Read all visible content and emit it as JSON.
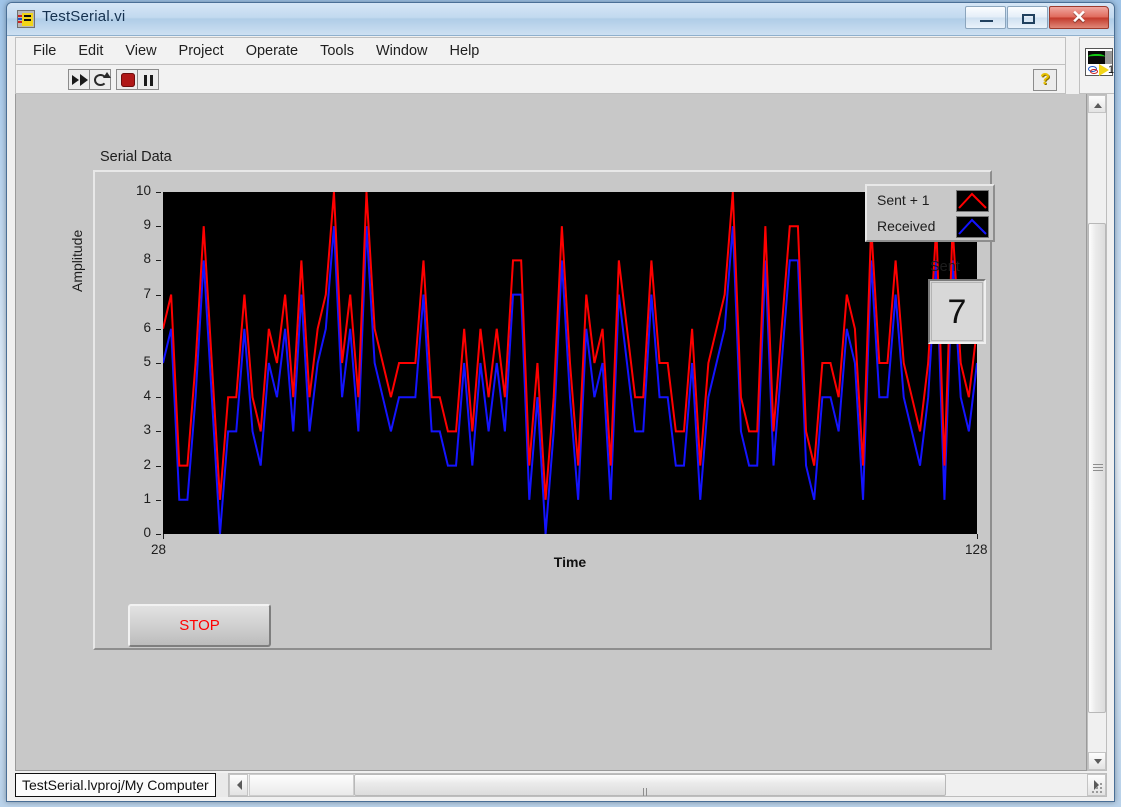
{
  "window": {
    "title": "TestSerial.vi",
    "icon": "labview-vi-icon",
    "minimize": "–",
    "maximize": "□",
    "close": "✕"
  },
  "menubar": {
    "items": [
      {
        "label": "File"
      },
      {
        "label": "Edit"
      },
      {
        "label": "View"
      },
      {
        "label": "Project"
      },
      {
        "label": "Operate"
      },
      {
        "label": "Tools"
      },
      {
        "label": "Window"
      },
      {
        "label": "Help"
      }
    ]
  },
  "toolbar": {
    "run": "run-arrow-icon",
    "run_continuously": "run-continuously-icon",
    "abort": "abort-execution-icon",
    "pause": "pause-icon",
    "help": "?",
    "vi_icon_number": "1"
  },
  "panel": {
    "graph_label": "Serial Data",
    "legend": {
      "rows": [
        {
          "name": "Sent + 1",
          "color": "#ff0000"
        },
        {
          "name": "Received",
          "color": "#1414ff"
        }
      ]
    },
    "sent_indicator": {
      "label": "Sent",
      "value": "7"
    },
    "stop_button": {
      "label": "STOP",
      "color": "#ff0000"
    }
  },
  "statusbar": {
    "project_path": "TestSerial.lvproj/My Computer"
  },
  "chart_data": {
    "type": "line",
    "title": "Serial Data",
    "xlabel": "Time",
    "ylabel": "Amplitude",
    "xlim": [
      28,
      128
    ],
    "ylim": [
      0,
      10
    ],
    "xticks": [
      28,
      128
    ],
    "yticks": [
      0,
      1,
      2,
      3,
      4,
      5,
      6,
      7,
      8,
      9,
      10
    ],
    "grid": false,
    "legend_position": "top-right",
    "plot_background": "#000000",
    "x": [
      28,
      29,
      30,
      31,
      32,
      33,
      34,
      35,
      36,
      37,
      38,
      39,
      40,
      41,
      42,
      43,
      44,
      45,
      46,
      47,
      48,
      49,
      50,
      51,
      52,
      53,
      54,
      55,
      56,
      57,
      58,
      59,
      60,
      61,
      62,
      63,
      64,
      65,
      66,
      67,
      68,
      69,
      70,
      71,
      72,
      73,
      74,
      75,
      76,
      77,
      78,
      79,
      80,
      81,
      82,
      83,
      84,
      85,
      86,
      87,
      88,
      89,
      90,
      91,
      92,
      93,
      94,
      95,
      96,
      97,
      98,
      99,
      100,
      101,
      102,
      103,
      104,
      105,
      106,
      107,
      108,
      109,
      110,
      111,
      112,
      113,
      114,
      115,
      116,
      117,
      118,
      119,
      120,
      121,
      122,
      123,
      124,
      125,
      126,
      127,
      128
    ],
    "series": [
      {
        "name": "Sent + 1",
        "color": "#ff0000",
        "values": [
          6,
          7,
          2,
          2,
          5,
          9,
          5,
          1,
          4,
          4,
          7,
          4,
          3,
          6,
          5,
          7,
          4,
          8,
          4,
          6,
          7,
          10,
          5,
          7,
          4,
          10,
          6,
          5,
          4,
          5,
          5,
          5,
          8,
          4,
          4,
          3,
          3,
          6,
          3,
          6,
          4,
          6,
          4,
          8,
          8,
          2,
          5,
          1,
          4,
          9,
          5,
          2,
          7,
          5,
          6,
          2,
          8,
          6,
          4,
          4,
          8,
          5,
          5,
          3,
          3,
          6,
          2,
          5,
          6,
          7,
          10,
          4,
          3,
          3,
          9,
          3,
          6,
          9,
          9,
          3,
          2,
          5,
          5,
          4,
          7,
          6,
          2,
          9,
          5,
          5,
          8,
          5,
          4,
          3,
          5,
          9,
          2,
          9,
          5,
          4,
          6
        ]
      },
      {
        "name": "Received",
        "color": "#1414ff",
        "values": [
          5,
          6,
          1,
          1,
          4,
          8,
          4,
          0,
          3,
          3,
          6,
          3,
          2,
          5,
          4,
          6,
          3,
          7,
          3,
          5,
          6,
          9,
          4,
          6,
          3,
          9,
          5,
          4,
          3,
          4,
          4,
          4,
          7,
          3,
          3,
          2,
          2,
          5,
          2,
          5,
          3,
          5,
          3,
          7,
          7,
          1,
          4,
          0,
          3,
          8,
          4,
          1,
          6,
          4,
          5,
          1,
          7,
          5,
          3,
          3,
          7,
          4,
          4,
          2,
          2,
          5,
          1,
          4,
          5,
          6,
          9,
          3,
          2,
          2,
          8,
          2,
          5,
          8,
          8,
          2,
          1,
          4,
          4,
          3,
          6,
          5,
          1,
          8,
          4,
          4,
          7,
          4,
          3,
          2,
          4,
          8,
          1,
          8,
          4,
          3,
          5
        ]
      }
    ]
  }
}
